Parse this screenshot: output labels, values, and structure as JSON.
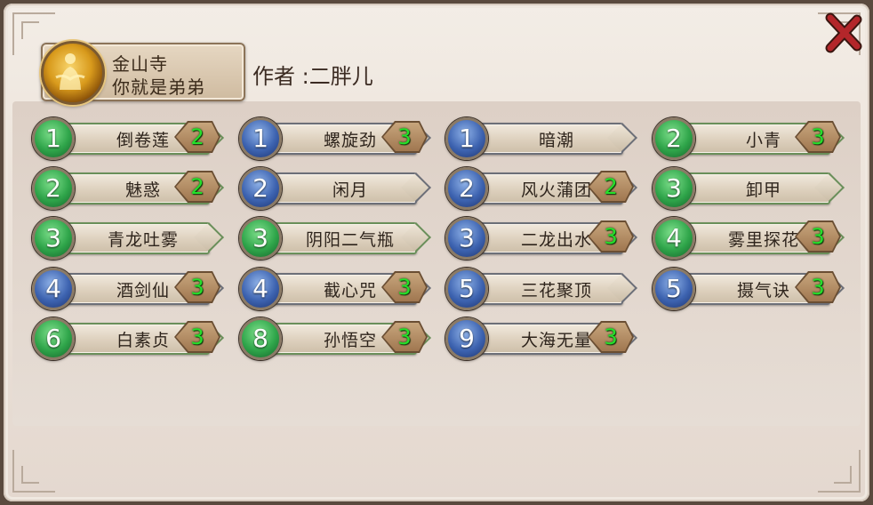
{
  "header": {
    "plate_line1": "金山寺",
    "plate_line2": "你就是弟弟",
    "author_label": "作者",
    "author_separator": ":",
    "author_name": "二胖儿"
  },
  "colors": {
    "green_level": "#2fa54a",
    "blue_level": "#3d63b0",
    "count_text": "#25e02a"
  },
  "skills": [
    {
      "level": "1",
      "name": "倒卷莲",
      "count": "2",
      "color": "green"
    },
    {
      "level": "1",
      "name": "螺旋劲",
      "count": "3",
      "color": "blue"
    },
    {
      "level": "1",
      "name": "暗潮",
      "count": "",
      "color": "blue"
    },
    {
      "level": "2",
      "name": "小青",
      "count": "3",
      "color": "green"
    },
    {
      "level": "2",
      "name": "魅惑",
      "count": "2",
      "color": "green"
    },
    {
      "level": "2",
      "name": "闲月",
      "count": "",
      "color": "blue"
    },
    {
      "level": "2",
      "name": "风火蒲团",
      "count": "2",
      "color": "blue"
    },
    {
      "level": "3",
      "name": "卸甲",
      "count": "",
      "color": "green"
    },
    {
      "level": "3",
      "name": "青龙吐雾",
      "count": "",
      "color": "green"
    },
    {
      "level": "3",
      "name": "阴阳二气瓶",
      "count": "",
      "color": "green"
    },
    {
      "level": "3",
      "name": "二龙出水",
      "count": "3",
      "color": "blue"
    },
    {
      "level": "4",
      "name": "雾里探花",
      "count": "3",
      "color": "green"
    },
    {
      "level": "4",
      "name": "酒剑仙",
      "count": "3",
      "color": "blue"
    },
    {
      "level": "4",
      "name": "截心咒",
      "count": "3",
      "color": "blue"
    },
    {
      "level": "5",
      "name": "三花聚顶",
      "count": "",
      "color": "blue"
    },
    {
      "level": "5",
      "name": "摄气诀",
      "count": "3",
      "color": "blue"
    },
    {
      "level": "6",
      "name": "白素贞",
      "count": "3",
      "color": "green"
    },
    {
      "level": "8",
      "name": "孙悟空",
      "count": "3",
      "color": "green"
    },
    {
      "level": "9",
      "name": "大海无量",
      "count": "3",
      "color": "blue"
    }
  ]
}
